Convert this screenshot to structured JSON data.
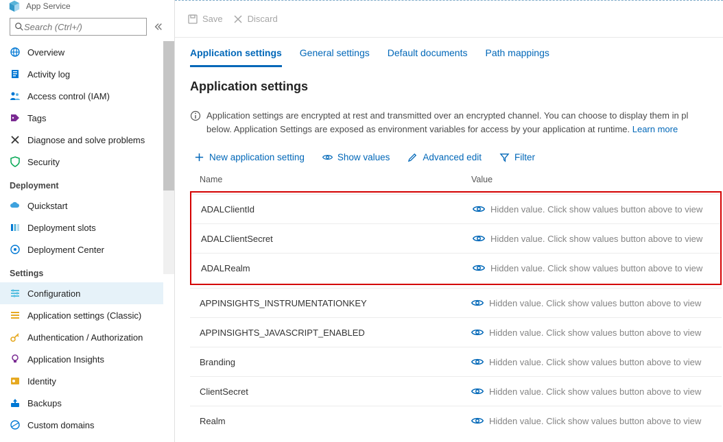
{
  "brand": {
    "subtitle": "App Service"
  },
  "search": {
    "placeholder": "Search (Ctrl+/)"
  },
  "sidebar": {
    "top_items": [
      {
        "label": "Overview",
        "name": "overview",
        "icon": "globe"
      },
      {
        "label": "Activity log",
        "name": "activity-log",
        "icon": "log"
      },
      {
        "label": "Access control (IAM)",
        "name": "access-control",
        "icon": "people"
      },
      {
        "label": "Tags",
        "name": "tags",
        "icon": "tag"
      },
      {
        "label": "Diagnose and solve problems",
        "name": "diagnose",
        "icon": "tools"
      },
      {
        "label": "Security",
        "name": "security",
        "icon": "shield"
      }
    ],
    "groups": [
      {
        "title": "Deployment",
        "items": [
          {
            "label": "Quickstart",
            "name": "quickstart",
            "icon": "cloud"
          },
          {
            "label": "Deployment slots",
            "name": "deployment-slots",
            "icon": "slots"
          },
          {
            "label": "Deployment Center",
            "name": "deployment-center",
            "icon": "center"
          }
        ]
      },
      {
        "title": "Settings",
        "items": [
          {
            "label": "Configuration",
            "name": "configuration",
            "icon": "sliders",
            "selected": true
          },
          {
            "label": "Application settings (Classic)",
            "name": "app-settings-classic",
            "icon": "list"
          },
          {
            "label": "Authentication / Authorization",
            "name": "auth",
            "icon": "key"
          },
          {
            "label": "Application Insights",
            "name": "app-insights",
            "icon": "bulb"
          },
          {
            "label": "Identity",
            "name": "identity",
            "icon": "identity"
          },
          {
            "label": "Backups",
            "name": "backups",
            "icon": "backup"
          },
          {
            "label": "Custom domains",
            "name": "custom-domains",
            "icon": "domain"
          }
        ]
      }
    ]
  },
  "toolbar": {
    "save_label": "Save",
    "discard_label": "Discard"
  },
  "tabs": [
    {
      "label": "Application settings",
      "name": "application-settings",
      "active": true
    },
    {
      "label": "General settings",
      "name": "general-settings"
    },
    {
      "label": "Default documents",
      "name": "default-documents"
    },
    {
      "label": "Path mappings",
      "name": "path-mappings"
    }
  ],
  "section_title": "Application settings",
  "info_text_1": "Application settings are encrypted at rest and transmitted over an encrypted channel. You can choose to display them in pl",
  "info_text_2": "below. Application Settings are exposed as environment variables for access by your application at runtime. ",
  "learn_more": "Learn more",
  "actions": {
    "new": "New application setting",
    "show": "Show values",
    "edit": "Advanced edit",
    "filter": "Filter"
  },
  "table": {
    "col_name": "Name",
    "col_value": "Value",
    "hidden_text": "Hidden value. Click show values button above to view",
    "rows_highlighted": [
      {
        "name": "ADALClientId"
      },
      {
        "name": "ADALClientSecret"
      },
      {
        "name": "ADALRealm"
      }
    ],
    "rows": [
      {
        "name": "APPINSIGHTS_INSTRUMENTATIONKEY"
      },
      {
        "name": "APPINSIGHTS_JAVASCRIPT_ENABLED"
      },
      {
        "name": "Branding"
      },
      {
        "name": "ClientSecret"
      },
      {
        "name": "Realm"
      }
    ]
  }
}
